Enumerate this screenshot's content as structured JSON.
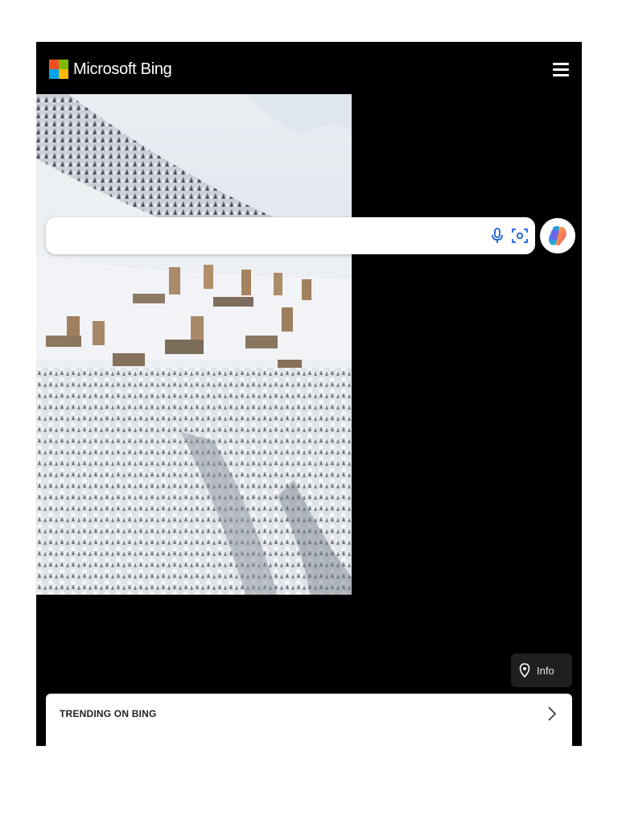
{
  "header": {
    "brand": "Microsoft Bing",
    "logo_colors": [
      "#f25022",
      "#7fba00",
      "#00a4ef",
      "#ffb900"
    ],
    "menu_icon": "hamburger-menu-icon"
  },
  "hero": {
    "subject": "snow-covered mountain village"
  },
  "search": {
    "value": "",
    "placeholder": "",
    "icons": [
      "microphone-icon",
      "visual-search-icon"
    ]
  },
  "copilot": {
    "icon": "copilot-icon"
  },
  "info": {
    "label": "Info",
    "icon": "location-pin-icon"
  },
  "trending": {
    "title": "TRENDING ON BING",
    "icon": "chevron-right-icon"
  },
  "colors": {
    "page_background": "#ffffff",
    "frame_background": "#000000",
    "info_button": "#1f1f1f"
  }
}
